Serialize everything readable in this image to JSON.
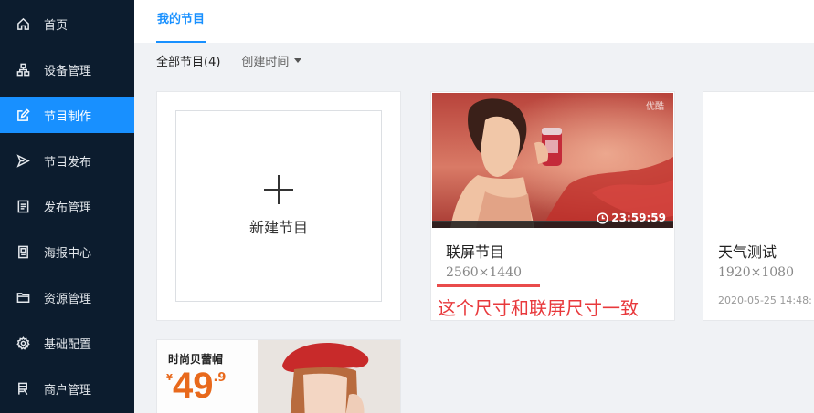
{
  "sidebar": {
    "items": [
      {
        "label": "首页",
        "icon": "home-icon"
      },
      {
        "label": "设备管理",
        "icon": "devices-icon"
      },
      {
        "label": "节目制作",
        "icon": "edit-icon",
        "active": true
      },
      {
        "label": "节目发布",
        "icon": "send-icon"
      },
      {
        "label": "发布管理",
        "icon": "list-doc-icon"
      },
      {
        "label": "海报中心",
        "icon": "poster-icon"
      },
      {
        "label": "资源管理",
        "icon": "folder-icon"
      },
      {
        "label": "基础配置",
        "icon": "gear-icon"
      },
      {
        "label": "商户管理",
        "icon": "merchant-icon"
      }
    ]
  },
  "main": {
    "tab": "我的节目",
    "filter": {
      "all_label": "全部节目(4)",
      "sort_label": "创建时间"
    },
    "new_program": {
      "label": "新建节目"
    },
    "programs": [
      {
        "title": "联屏节目",
        "size": "2560×1440",
        "duration": "23:59:59",
        "watermark": "优酷"
      },
      {
        "title": "天气测试",
        "size": "1920×1080",
        "date": "2020-05-25 14:48:"
      }
    ],
    "poster": {
      "headline": "时尚贝蕾帽",
      "currency": "¥",
      "price": "49",
      "cents": ".9"
    }
  },
  "annotation": {
    "text": "这个尺寸和联屏尺寸一致",
    "color": "#e8393c"
  },
  "colors": {
    "sidebar_bg": "#0c1c2e",
    "accent": "#1890ff"
  }
}
